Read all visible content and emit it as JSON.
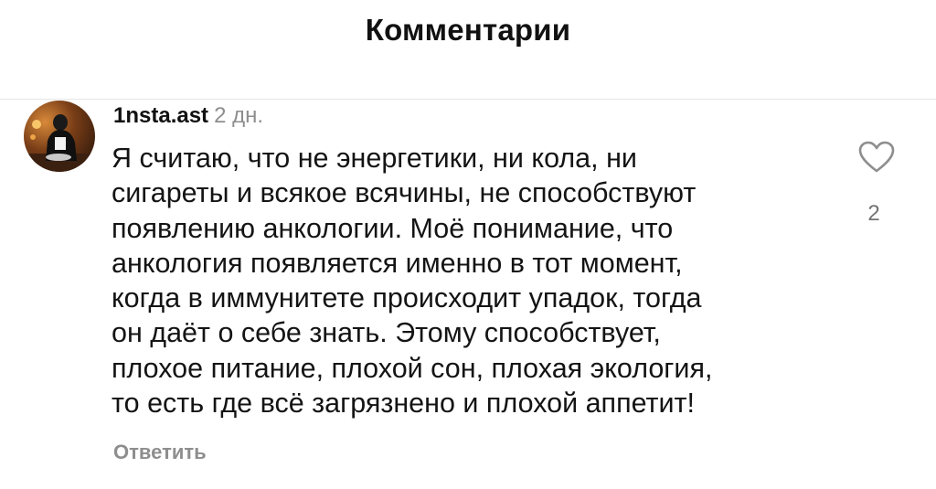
{
  "header": {
    "title": "Комментарии"
  },
  "comment": {
    "username": "1nsta.ast",
    "timestamp": "2 дн.",
    "avatar_icon": "user-avatar-photo",
    "lines": [
      "Я считаю, что не энергетики, ни кола, ни",
      "сигареты и всякое всячины, не способствуют",
      "появлению анкологии. Моё понимание, что",
      "анкология появляется именно в тот момент,",
      "когда в иммунитете происходит упадок, тогда",
      "он даёт о себе знать. Этому способствует,",
      "плохое питание, плохой сон, плохая экология,",
      "то есть где всё загрязнено и плохой аппетит!"
    ],
    "like_icon": "heart-outline-icon",
    "like_count": "2",
    "reply_label": "Ответить"
  },
  "colors": {
    "text": "#141414",
    "secondary": "#8e8e8e",
    "divider": "#e6e6e6",
    "background": "#ffffff"
  }
}
